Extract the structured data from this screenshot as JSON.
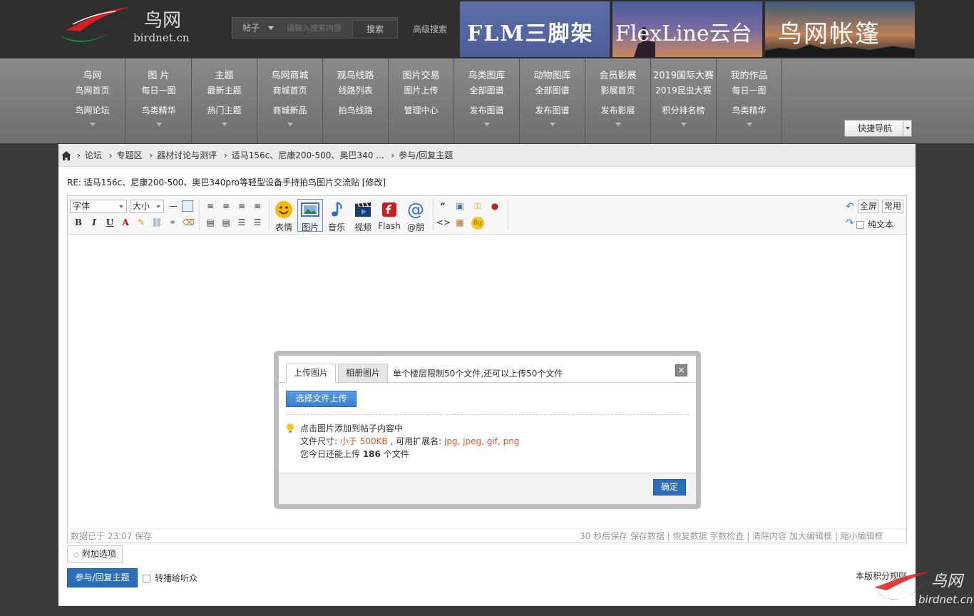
{
  "header": {
    "logo_cn": "鸟网",
    "logo_en": "birdnet.cn",
    "search_type": "帖子",
    "search_placeholder": "请输入搜索内容",
    "search_button": "搜索",
    "advanced_search": "高级搜索",
    "ads": [
      "FLM三脚架",
      "FlexLine云台",
      "鸟网帐篷"
    ]
  },
  "nav": [
    {
      "title": "鸟网",
      "sub1": "鸟网首页",
      "sub2": "鸟网论坛"
    },
    {
      "title": "图 片",
      "sub1": "每日一图",
      "sub2": "鸟类精华"
    },
    {
      "title": "主题",
      "sub1": "最新主题",
      "sub2": "热门主题"
    },
    {
      "title": "鸟网商城",
      "sub1": "商城首页",
      "sub2": "商城新品"
    },
    {
      "title": "观鸟线路",
      "sub1": "线路列表",
      "sub2": "拍鸟线路"
    },
    {
      "title": "图片交易",
      "sub1": "图片上传",
      "sub2": "管理中心"
    },
    {
      "title": "鸟类图库",
      "sub1": "全部图谱",
      "sub2": "发布图谱"
    },
    {
      "title": "动物图库",
      "sub1": "全部图谱",
      "sub2": "发布图谱"
    },
    {
      "title": "会员影展",
      "sub1": "影展首页",
      "sub2": "发布影展"
    },
    {
      "title": "2019国际大赛",
      "sub1": "2019昆虫大赛",
      "sub2": "积分排名榜"
    },
    {
      "title": "我的作品",
      "sub1": "每日一图",
      "sub2": "鸟类精华"
    }
  ],
  "quick_nav": "快捷导航",
  "breadcrumb": [
    "论坛",
    "专题区",
    "器材讨论与测评",
    "适马156c、尼康200-500、奥巴340 ...",
    "参与/回复主题"
  ],
  "post_title": "RE: 适马156c、尼康200-500、奥巴340pro等轻型设备手持拍鸟图片交流贴 [修改]",
  "editor": {
    "font_select": "字体",
    "size_select": "大小",
    "buttons": [
      "表情",
      "图片",
      "音乐",
      "视频",
      "Flash",
      "@朋"
    ],
    "fullscreen": "全屏",
    "common": "常用",
    "plaintext": "纯文本",
    "status_left": "数据已于 23:07 保存",
    "status_right": "30 秒后保存 保存数据 | 恢复数据    字数检查 | 清除内容    加大编辑框 | 缩小编辑框"
  },
  "extra_options": "附加选项",
  "submit_button": "参与/回复主题",
  "share_label": "转播给听众",
  "rules_link": "本版积分规则",
  "watermark": {
    "cn": "鸟网",
    "en": "birdnet.cn"
  },
  "modal": {
    "tab_upload": "上传图片",
    "tab_album": "相册图片",
    "limit_note": "单个楼层限制50个文件,还可以上传50个文件",
    "close": "×",
    "upload_button": "选择文件上传",
    "tip1": "点击图片添加到帖子内容中",
    "size_prefix": "文件尺寸: ",
    "size_value": "小于 500KB",
    "ext_prefix": " , 可用扩展名: ",
    "ext_value": "jpg, jpeg, gif, png",
    "today_prefix": "您今日还能上传 ",
    "today_count": "186",
    "today_suffix": " 个文件",
    "ok_button": "确定"
  },
  "colors": {
    "accent": "#2c6dba",
    "nav_bg": "#7c7c7c",
    "topbar_bg": "#2f2f2f",
    "highlight": "#e0552b"
  }
}
